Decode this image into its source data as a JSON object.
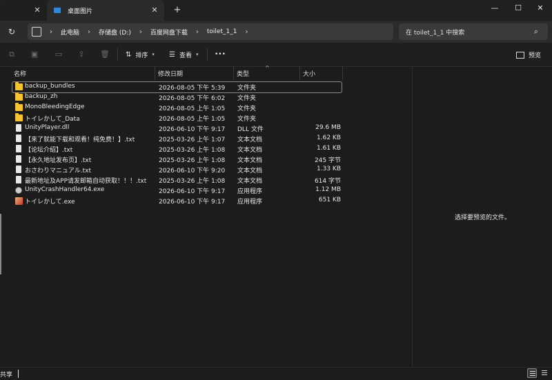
{
  "tabs": [
    {
      "title": ""
    },
    {
      "title": "桌面图片"
    }
  ],
  "window": {
    "new_tab": "+",
    "minimize": "—",
    "maximize": "☐",
    "close": "✕"
  },
  "address": {
    "breadcrumbs": [
      "此电脑",
      "存储盘 (D:)",
      "百度网盘下载",
      "toilet_1_1"
    ],
    "sep": "›"
  },
  "search": {
    "placeholder": "在 toilet_1_1 中搜索"
  },
  "toolbar": {
    "sort_label": "排序",
    "view_label": "查看",
    "more_label": "•••",
    "preview_label": "预览"
  },
  "columns": {
    "name": "名称",
    "date": "修改日期",
    "type": "类型",
    "size": "大小"
  },
  "files": [
    {
      "name": "backup_bundles",
      "date": "2026-08-05 下午 5:39",
      "type": "文件夹",
      "size": "",
      "icon": "folder-icon"
    },
    {
      "name": "backup_zh",
      "date": "2026-08-05 下午 6:02",
      "type": "文件夹",
      "size": "",
      "icon": "folder-icon"
    },
    {
      "name": "MonoBleedingEdge",
      "date": "2026-08-05 上午 1:05",
      "type": "文件夹",
      "size": "",
      "icon": "folder-icon"
    },
    {
      "name": "トイレかして_Data",
      "date": "2026-08-05 上午 1:05",
      "type": "文件夹",
      "size": "",
      "icon": "folder-icon"
    },
    {
      "name": "UnityPlayer.dll",
      "date": "2026-06-10 下午 9:17",
      "type": "DLL 文件",
      "size": "29.6 MB",
      "icon": "file-icon"
    },
    {
      "name": "【来了就能下载和观看！纯免费！】.txt",
      "date": "2025-03-26 上午 1:07",
      "type": "文本文档",
      "size": "1.62 KB",
      "icon": "file-icon"
    },
    {
      "name": "【论坛介绍】.txt",
      "date": "2025-03-26 上午 1:08",
      "type": "文本文档",
      "size": "1.61 KB",
      "icon": "file-icon"
    },
    {
      "name": "【永久地址发布页】.txt",
      "date": "2025-03-26 上午 1:08",
      "type": "文本文档",
      "size": "245 字节",
      "icon": "file-icon"
    },
    {
      "name": "おさわりマニュアル.txt",
      "date": "2026-06-10 下午 9:20",
      "type": "文本文档",
      "size": "1.33 KB",
      "icon": "file-icon"
    },
    {
      "name": "最新地址及APP请发邮箱自动获取！！！.txt",
      "date": "2025-03-26 上午 1:08",
      "type": "文本文档",
      "size": "614 字节",
      "icon": "file-icon"
    },
    {
      "name": "UnityCrashHandler64.exe",
      "date": "2026-06-10 下午 9:17",
      "type": "应用程序",
      "size": "1.12 MB",
      "icon": "app-icon"
    },
    {
      "name": "トイレかして.exe",
      "date": "2026-06-10 下午 9:17",
      "type": "应用程序",
      "size": "651 KB",
      "icon": "game-app-icon"
    }
  ],
  "preview_message": "选择要预览的文件。",
  "status": {
    "text": "共享"
  },
  "colors": {
    "background": "#1c1c1c",
    "folder": "#f4c430",
    "accent": "#2e86de"
  }
}
